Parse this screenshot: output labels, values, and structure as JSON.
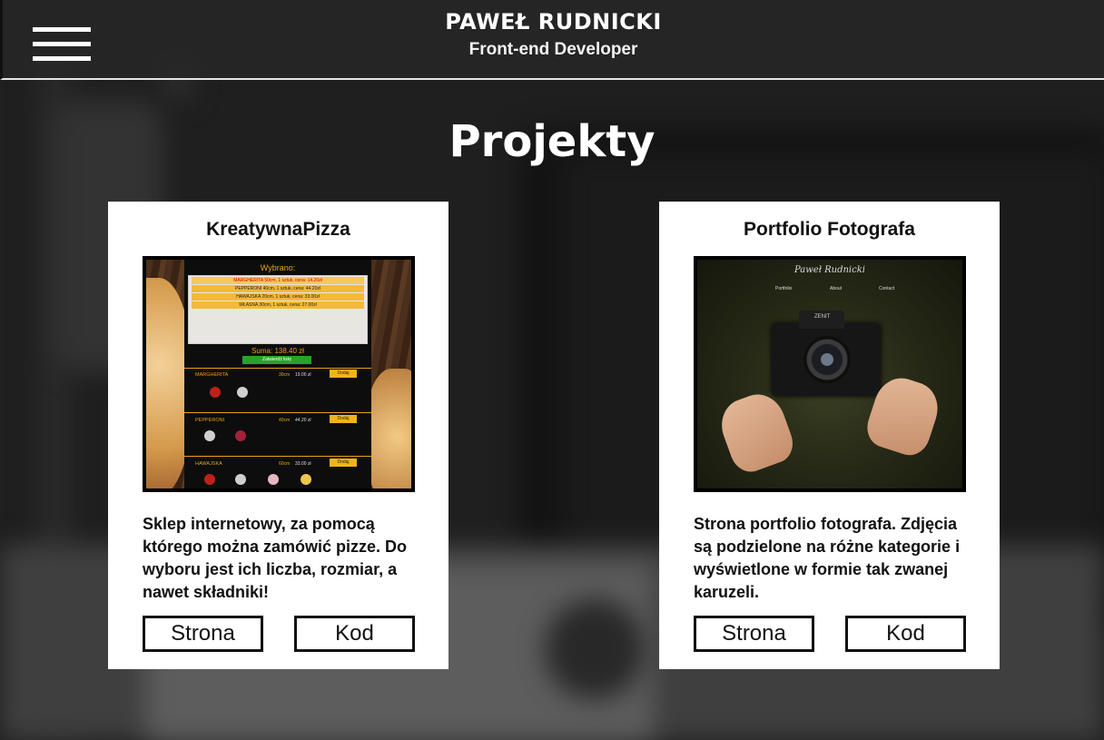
{
  "header": {
    "name": "PAWEŁ RUDNICKI",
    "role": "Front-end Developer",
    "menu_icon": "hamburger-menu-icon"
  },
  "section": {
    "title": "Projekty"
  },
  "projects": [
    {
      "title": "KreatywnaPizza",
      "description": "Sklep internetowy, za pomocą którego można zamówić pizze. Do wyboru jest ich liczba, rozmiar, a nawet składniki!",
      "site_label": "Strona",
      "code_label": "Kod",
      "preview": {
        "chosen_label": "Wybrano:",
        "chosen_rows": [
          "MARGHERITA 50cm, 1 sztuk, cena: 14.20zł",
          "PEPPERONI 40cm, 1 sztuk, cena: 44.20zł",
          "HAWAJSKA 20cm, 1 sztuk, cena: 33.00zł",
          "WŁASNA 30cm, 1 sztuk, cena: 27.00zł"
        ],
        "sum_label": "Suma: 138.40 zł",
        "confirm_label": "Zatwierdź listę",
        "add_label": "Dodaj",
        "pizzas": [
          {
            "name": "MARGHERITA",
            "size": "30cm",
            "price": "19.00 zł"
          },
          {
            "name": "PEPPERONI",
            "size": "40cm",
            "price": "44.20 zł"
          },
          {
            "name": "HAWAJSKA",
            "size": "60cm",
            "price": "33.00 zł"
          }
        ]
      }
    },
    {
      "title": "Portfolio Fotografa",
      "description": "Strona portfolio fotografa. Zdjęcia są podzielone na różne kategorie i wyświetlone w formie tak zwanej karuzeli.",
      "site_label": "Strona",
      "code_label": "Kod",
      "preview": {
        "logo": "Paweł Rudnicki",
        "nav": [
          "Portfolio",
          "About",
          "Contact"
        ],
        "camera_brand": "ZENIT"
      }
    }
  ]
}
